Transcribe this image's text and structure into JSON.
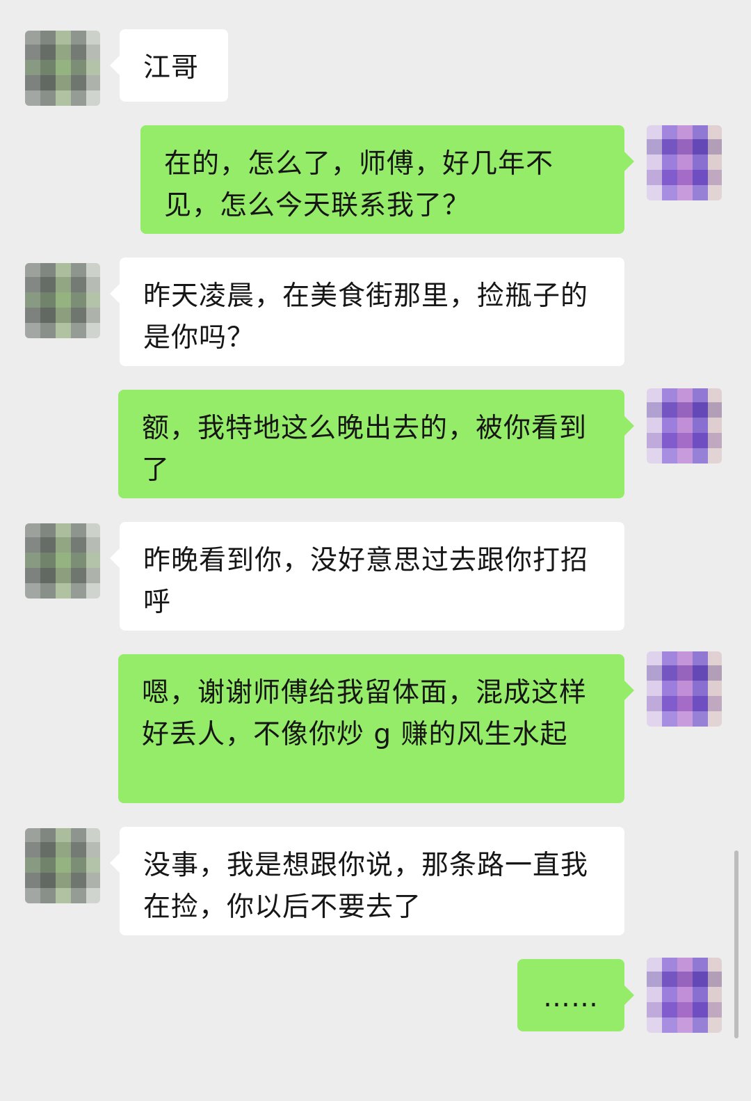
{
  "messages": [
    {
      "sender": "other",
      "text": "江哥"
    },
    {
      "sender": "self",
      "text": "在的，怎么了，师傅，好几年不见，怎么今天联系我了？"
    },
    {
      "sender": "other",
      "text": "昨天凌晨，在美食街那里，捡瓶子的是你吗？"
    },
    {
      "sender": "self",
      "text": "额，我特地这么晚出去的，被你看到了"
    },
    {
      "sender": "other",
      "text": "昨晚看到你，没好意思过去跟你打招呼"
    },
    {
      "sender": "self",
      "text": "嗯，谢谢师傅给我留体面，混成这样好丢人，不像你炒 g 赚的风生水起"
    },
    {
      "sender": "other",
      "text": "没事，我是想跟你说，那条路一直我在捡，你以后不要去了"
    },
    {
      "sender": "self",
      "text": "……"
    }
  ],
  "colors": {
    "background": "#ededed",
    "self_bubble": "#95ec69",
    "other_bubble": "#ffffff"
  }
}
